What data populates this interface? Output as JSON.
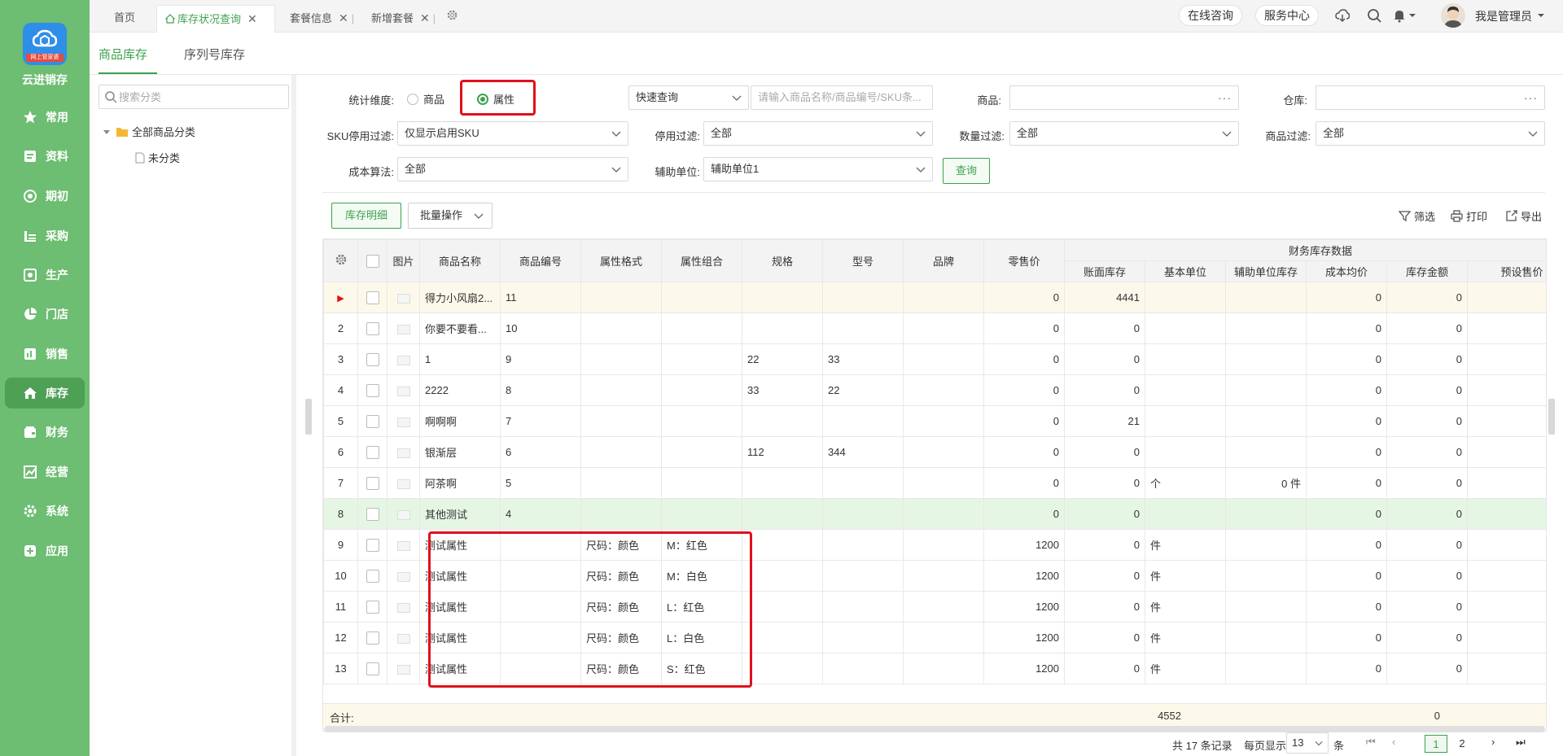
{
  "app": {
    "name": "云进销存",
    "logo_ribbon": "网上管家婆"
  },
  "nav": [
    "常用",
    "资料",
    "期初",
    "采购",
    "生产",
    "门店",
    "销售",
    "库存",
    "财务",
    "经营",
    "系统",
    "应用"
  ],
  "tabs": [
    {
      "label": "首页"
    },
    {
      "label": "库存状况查询"
    },
    {
      "label": "套餐信息"
    },
    {
      "label": "新增套餐"
    }
  ],
  "topbar": {
    "consult": "在线咨询",
    "service": "服务中心",
    "user": "我是管理员"
  },
  "subtabs": [
    "商品库存",
    "序列号库存"
  ],
  "tree": {
    "search_placeholder": "搜索分类",
    "root": "全部商品分类",
    "child": "未分类"
  },
  "filters": {
    "dimension_label": "统计维度:",
    "dim_product": "商品",
    "dim_attr": "属性",
    "quick_query": "快速查询",
    "quick_placeholder": "请输入商品名称/商品编号/SKU条...",
    "product_label": "商品:",
    "warehouse_label": "仓库:",
    "sku_label": "SKU停用过滤:",
    "sku_value": "仅显示启用SKU",
    "stop_label": "停用过滤:",
    "stop_value": "全部",
    "qty_label": "数量过滤:",
    "qty_value": "全部",
    "goods_label": "商品过滤:",
    "goods_value": "全部",
    "cost_label": "成本算法:",
    "cost_value": "全部",
    "aux_label": "辅助单位:",
    "aux_value": "辅助单位1",
    "query_btn": "查询"
  },
  "toolbar": {
    "detail": "库存明细",
    "batch": "批量操作",
    "filter": "筛选",
    "print": "打印",
    "export": "导出"
  },
  "table": {
    "group_header": "财务库存数据",
    "headers": [
      "图片",
      "商品名称",
      "商品编号",
      "属性格式",
      "属性组合",
      "规格",
      "型号",
      "品牌",
      "零售价",
      "账面库存",
      "基本单位",
      "辅助单位库存",
      "成本均价",
      "库存金额",
      "预设售价"
    ],
    "rows": [
      [
        "▶",
        "",
        "得力小风扇2...",
        "11",
        "",
        "",
        "",
        "",
        "",
        "0",
        "4441",
        "",
        "",
        "0",
        "0"
      ],
      [
        "2",
        "",
        "你要不要看...",
        "10",
        "",
        "",
        "",
        "",
        "",
        "0",
        "0",
        "",
        "",
        "0",
        "0"
      ],
      [
        "3",
        "",
        "1",
        "9",
        "",
        "",
        "22",
        "33",
        "",
        "0",
        "0",
        "",
        "",
        "0",
        "0"
      ],
      [
        "4",
        "",
        "2222",
        "8",
        "",
        "",
        "33",
        "22",
        "",
        "0",
        "0",
        "",
        "",
        "0",
        "0"
      ],
      [
        "5",
        "",
        "啊啊啊",
        "7",
        "",
        "",
        "",
        "",
        "",
        "0",
        "21",
        "",
        "",
        "0",
        "0"
      ],
      [
        "6",
        "",
        "银渐层",
        "6",
        "",
        "",
        "112",
        "344",
        "",
        "0",
        "0",
        "",
        "",
        "0",
        "0"
      ],
      [
        "7",
        "",
        "阿茶啊",
        "5",
        "",
        "",
        "",
        "",
        "",
        "0",
        "0",
        "个",
        "0 件",
        "0",
        "0"
      ],
      [
        "8",
        "",
        "其他测试",
        "4",
        "",
        "",
        "",
        "",
        "",
        "0",
        "0",
        "",
        "",
        "0",
        "0"
      ],
      [
        "9",
        "",
        "测试属性",
        "",
        "尺码：颜色",
        "M：红色",
        "",
        "",
        "",
        "1200",
        "0",
        "件",
        "",
        "0",
        "0"
      ],
      [
        "10",
        "",
        "测试属性",
        "",
        "尺码：颜色",
        "M：白色",
        "",
        "",
        "",
        "1200",
        "0",
        "件",
        "",
        "0",
        "0"
      ],
      [
        "11",
        "",
        "测试属性",
        "",
        "尺码：颜色",
        "L：红色",
        "",
        "",
        "",
        "1200",
        "0",
        "件",
        "",
        "0",
        "0"
      ],
      [
        "12",
        "",
        "测试属性",
        "",
        "尺码：颜色",
        "L：白色",
        "",
        "",
        "",
        "1200",
        "0",
        "件",
        "",
        "0",
        "0"
      ],
      [
        "13",
        "",
        "测试属性",
        "",
        "尺码：颜色",
        "S：红色",
        "",
        "",
        "",
        "1200",
        "0",
        "件",
        "",
        "0",
        "0"
      ]
    ],
    "sum_label": "合计:",
    "sum_stock": "4552",
    "sum_amount": "0"
  },
  "pager": {
    "total": "共 17 条记录",
    "per_page_label": "每页显示",
    "per_page": "13",
    "unit": "条",
    "pages": [
      "1",
      "2"
    ]
  },
  "colors": {
    "accent": "#3da14f",
    "sidebar": "#6dbd72",
    "highlight": "#e0101a"
  }
}
